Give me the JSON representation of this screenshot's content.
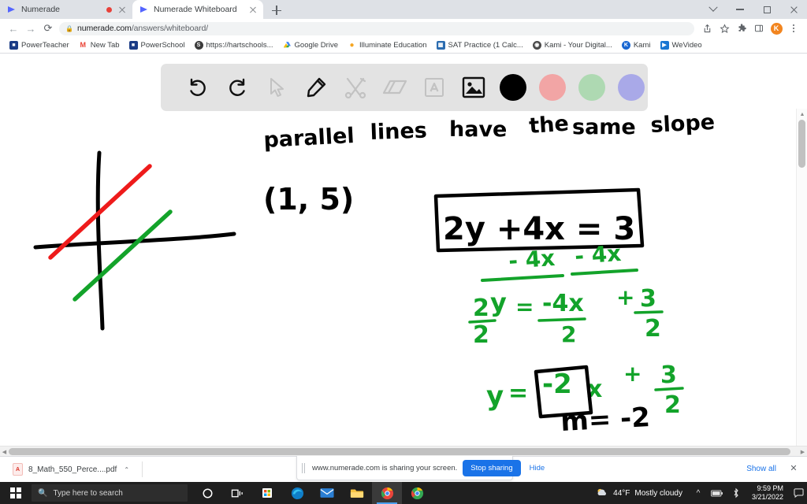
{
  "browser": {
    "tabs": [
      {
        "title": "Numerade",
        "icon": "numerade-favicon",
        "active": false,
        "recording": true
      },
      {
        "title": "Numerade Whiteboard",
        "icon": "numerade-favicon",
        "active": true,
        "recording": false
      }
    ],
    "new_tab_label": "+",
    "window_controls": [
      "minimize-all",
      "minimize",
      "maximize",
      "close"
    ],
    "nav": {
      "back": "←",
      "forward": "→",
      "reload": "⟳"
    },
    "omnibox": {
      "lock_icon": "lock-icon",
      "url_domain": "numerade.com",
      "url_path": "/answers/whiteboard/"
    },
    "omnibox_actions": [
      "share-icon",
      "bookmark-star-icon",
      "extensions-icon",
      "side-panel-icon"
    ],
    "profile_initial": "K",
    "bookmarks": [
      {
        "label": "PowerTeacher",
        "icon_text": "PT",
        "icon_color": "#1b3c86"
      },
      {
        "label": "New Tab",
        "icon_text": "M",
        "icon_color": "#ffffff"
      },
      {
        "label": "PowerSchool",
        "icon_text": "PS",
        "icon_color": "#1b3c86"
      },
      {
        "label": "https://hartschools...",
        "icon_text": "S",
        "icon_color": "#3b3b3b"
      },
      {
        "label": "Google Drive",
        "icon_text": "△",
        "icon_color": "#ffffff"
      },
      {
        "label": "Illuminate Education",
        "icon_text": "●",
        "icon_color": "#ffffff"
      },
      {
        "label": "SAT Practice (1 Calc...",
        "icon_text": "▦",
        "icon_color": "#2b6cb0"
      },
      {
        "label": "Kami - Your Digital...",
        "icon_text": "●",
        "icon_color": "#4a4a4a"
      },
      {
        "label": "Kami",
        "icon_text": "K",
        "icon_color": "#1967d2"
      },
      {
        "label": "WeVideo",
        "icon_text": "▶",
        "icon_color": "#1976d2"
      }
    ]
  },
  "whiteboard": {
    "toolbar": {
      "background": "#e3e3e3",
      "tools": [
        {
          "name": "undo-icon",
          "label": "Undo",
          "state": "enabled"
        },
        {
          "name": "redo-icon",
          "label": "Redo",
          "state": "enabled"
        },
        {
          "name": "cursor-icon",
          "label": "Select",
          "state": "disabled"
        },
        {
          "name": "pencil-icon",
          "label": "Pen",
          "state": "active"
        },
        {
          "name": "tools-icon",
          "label": "Tools",
          "state": "disabled"
        },
        {
          "name": "eraser-icon",
          "label": "Eraser",
          "state": "disabled"
        },
        {
          "name": "text-icon",
          "label": "Text",
          "state": "disabled"
        },
        {
          "name": "image-icon",
          "label": "Image",
          "state": "enabled"
        }
      ],
      "colors": [
        {
          "name": "color-black",
          "hex": "#000000",
          "selected": true
        },
        {
          "name": "color-red",
          "hex": "#f2a5a5",
          "selected": false
        },
        {
          "name": "color-green",
          "hex": "#aed9b2",
          "selected": false
        },
        {
          "name": "color-purple",
          "hex": "#a9a9e8",
          "selected": false
        }
      ]
    },
    "annotations": {
      "heading": "parallel lines have the same slope",
      "point": "(1, 5)",
      "boxed_equation": "2y + 4x = 3",
      "subtract_step": "- 4x  - 4x",
      "divide_step": "2y/2 = -4x/2 + 3/2",
      "solved": "y = -2x + 3/2",
      "slope": "m = -2",
      "ink_black": "#000000",
      "ink_green": "#13a32a",
      "ink_red": "#ee1b1b"
    }
  },
  "download_shelf": {
    "file_name": "8_Math_550_Perce....pdf",
    "caret": "⌃",
    "show_all_label": "Show all",
    "close_label": "✕"
  },
  "share_bar": {
    "message": "www.numerade.com is sharing your screen.",
    "stop_label": "Stop sharing",
    "hide_label": "Hide"
  },
  "taskbar": {
    "start_label": "windows-start",
    "search_placeholder": "Type here to search",
    "search_icon": "search-icon",
    "items": [
      {
        "name": "cortana-icon",
        "glyph": "○",
        "color": "#ffffff",
        "active": false
      },
      {
        "name": "task-view-icon",
        "glyph": "⌸",
        "color": "#ffffff",
        "active": false
      },
      {
        "name": "microsoft-store-icon",
        "glyph": "▣",
        "color": "#ffffff",
        "active": false
      },
      {
        "name": "edge-icon",
        "glyph": "◔",
        "color": "#1a9cd8",
        "active": false
      },
      {
        "name": "mail-icon",
        "glyph": "✉",
        "color": "#2b7fd4",
        "active": false
      },
      {
        "name": "file-explorer-icon",
        "glyph": "▭",
        "color": "#f5c242",
        "active": false
      },
      {
        "name": "chrome-icon",
        "glyph": "◉",
        "color": "#e8453c",
        "active": true
      },
      {
        "name": "chrome-icon-2",
        "glyph": "◉",
        "color": "#34a853",
        "active": false
      }
    ],
    "tray": {
      "temperature": "44°F",
      "weather": "Mostly cloudy",
      "overflow_icon": "chevron-up-icon",
      "battery_icon": "battery-icon",
      "bluetooth_icon": "bluetooth-icon",
      "time": "9:59 PM",
      "date": "3/21/2022",
      "notification_icon": "notification-icon"
    }
  }
}
